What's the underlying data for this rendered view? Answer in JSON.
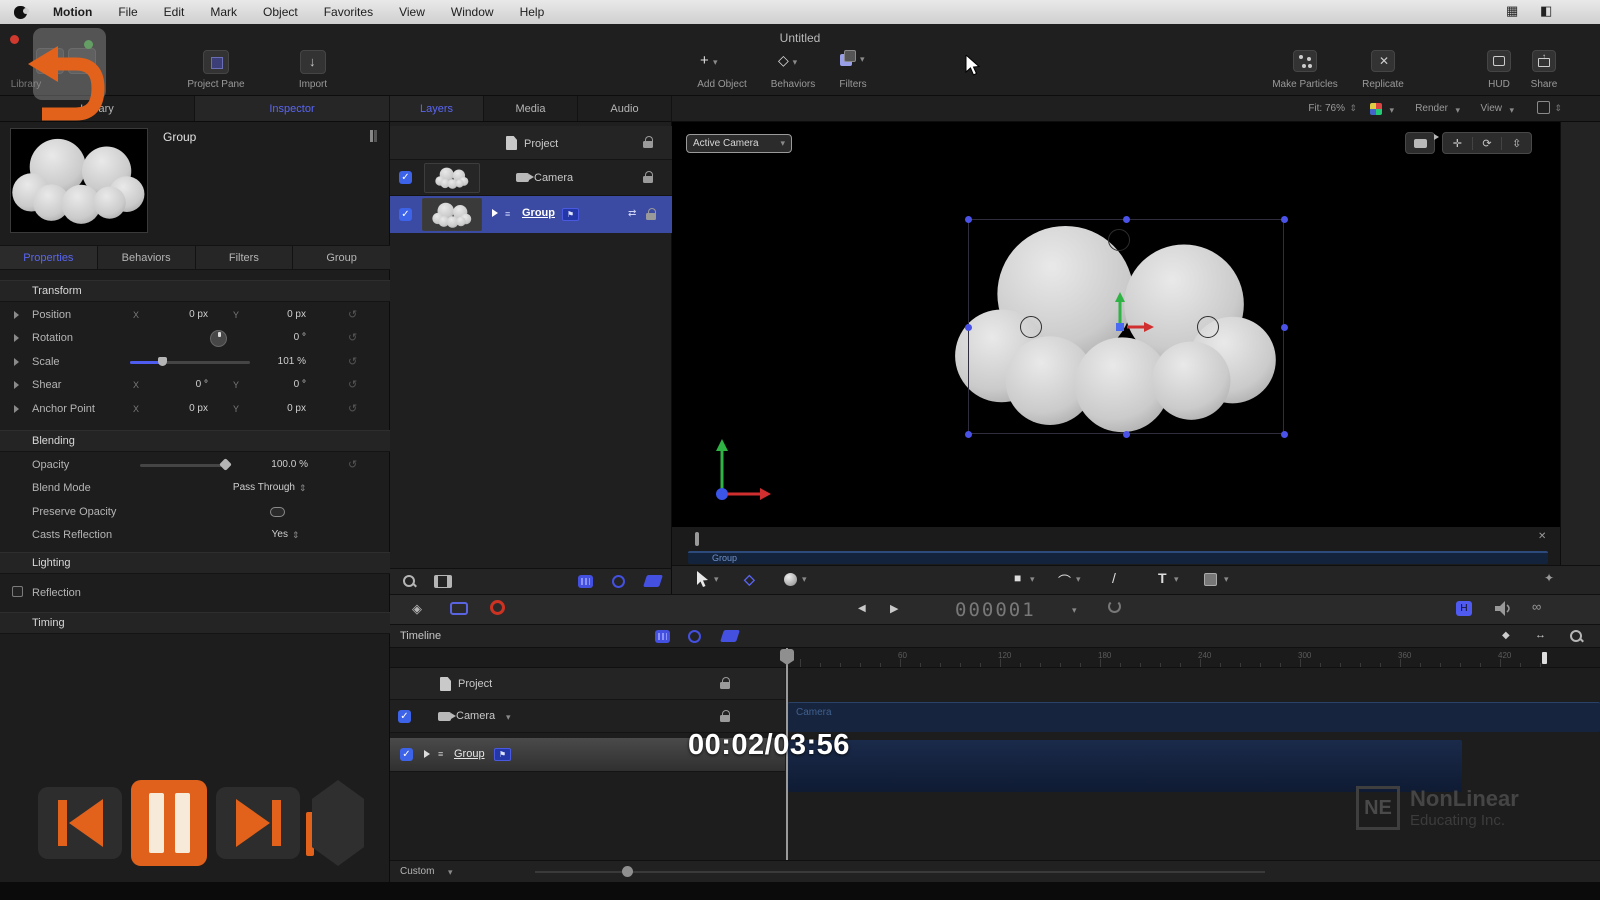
{
  "menubar": {
    "items": [
      "Motion",
      "File",
      "Edit",
      "Mark",
      "Object",
      "Favorites",
      "View",
      "Window",
      "Help"
    ]
  },
  "window": {
    "title": "Untitled"
  },
  "toolbar": {
    "library": "Library",
    "inspector": "Inspector",
    "project_pane": "Project Pane",
    "import": "Import",
    "add_object": "Add Object",
    "behaviors": "Behaviors",
    "filters": "Filters",
    "make_particles": "Make Particles",
    "replicate": "Replicate",
    "hud": "HUD",
    "share": "Share"
  },
  "panel_tabs": {
    "left": [
      "Library",
      "Inspector"
    ],
    "middle": [
      "Layers",
      "Media",
      "Audio"
    ]
  },
  "canvas_header": {
    "fit": "Fit: 76%",
    "render": "Render",
    "view": "View"
  },
  "viewport": {
    "camera_select": "Active Camera",
    "group_bar_label": "Group"
  },
  "inspector": {
    "preview_label": "Group",
    "tabs": [
      "Properties",
      "Behaviors",
      "Filters",
      "Group"
    ],
    "transform": {
      "title": "Transform",
      "rows": [
        {
          "label": "Position",
          "x_label": "X",
          "x_value": "0 px",
          "y_label": "Y",
          "y_value": "0 px"
        },
        {
          "label": "Rotation",
          "value": "0 °"
        },
        {
          "label": "Scale",
          "value": "101 %"
        },
        {
          "label": "Shear",
          "x_label": "X",
          "x_value": "0 °",
          "y_label": "Y",
          "y_value": "0 °"
        },
        {
          "label": "Anchor Point",
          "x_label": "X",
          "x_value": "0 px",
          "y_label": "Y",
          "y_value": "0 px"
        }
      ]
    },
    "blending": {
      "title": "Blending",
      "opacity_label": "Opacity",
      "opacity_value": "100.0 %",
      "blend_mode_label": "Blend Mode",
      "blend_mode_value": "Pass Through",
      "preserve_opacity_label": "Preserve Opacity",
      "casts_reflection_label": "Casts Reflection",
      "casts_reflection_value": "Yes"
    },
    "lighting_title": "Lighting",
    "reflection_label": "Reflection",
    "timing_title": "Timing"
  },
  "layers": {
    "rows": [
      {
        "name": "Project"
      },
      {
        "name": "Camera"
      },
      {
        "name": "Group"
      }
    ]
  },
  "transport": {
    "timecode": "000001"
  },
  "timeline": {
    "title": "Timeline",
    "rows": [
      {
        "name": "Project"
      },
      {
        "name": "Camera"
      },
      {
        "name": "Group"
      }
    ],
    "ruler_ticks": [
      "60",
      "120",
      "180",
      "240",
      "300",
      "360",
      "420"
    ],
    "camera_track_label": "Camera",
    "footer_preset": "Custom"
  },
  "player_overlay": {
    "timestamp": "00:02/03:56",
    "watermark_logo": "NE",
    "watermark_line1": "NonLinear",
    "watermark_line2": "Educating Inc."
  },
  "icons": {
    "chevron_down": "▾",
    "updown": "⇕",
    "disclosure": "▸",
    "plus": "+",
    "diamond": "◇",
    "prev_frame": "◀",
    "play": "▶",
    "loop": "∞",
    "close": "✕",
    "sparkle": "✦",
    "double_arrow": "↔",
    "keyframe": "◆",
    "text_tool": "T",
    "line_tool": "/",
    "rect_tool": "■",
    "curve_tool": "⌒",
    "cursor": "➤",
    "list": "≡",
    "flag": "⚑",
    "link": "⇄",
    "down_arrow": "↓",
    "orbit": "⟳",
    "move": "✛",
    "dolly": "⇳",
    "grid": "▦"
  },
  "colors": {
    "accent_orange": "#e2621b",
    "accent_blue": "#4450e0",
    "selection_blue": "#3b4aa2",
    "timecode_gray": "#787878"
  }
}
